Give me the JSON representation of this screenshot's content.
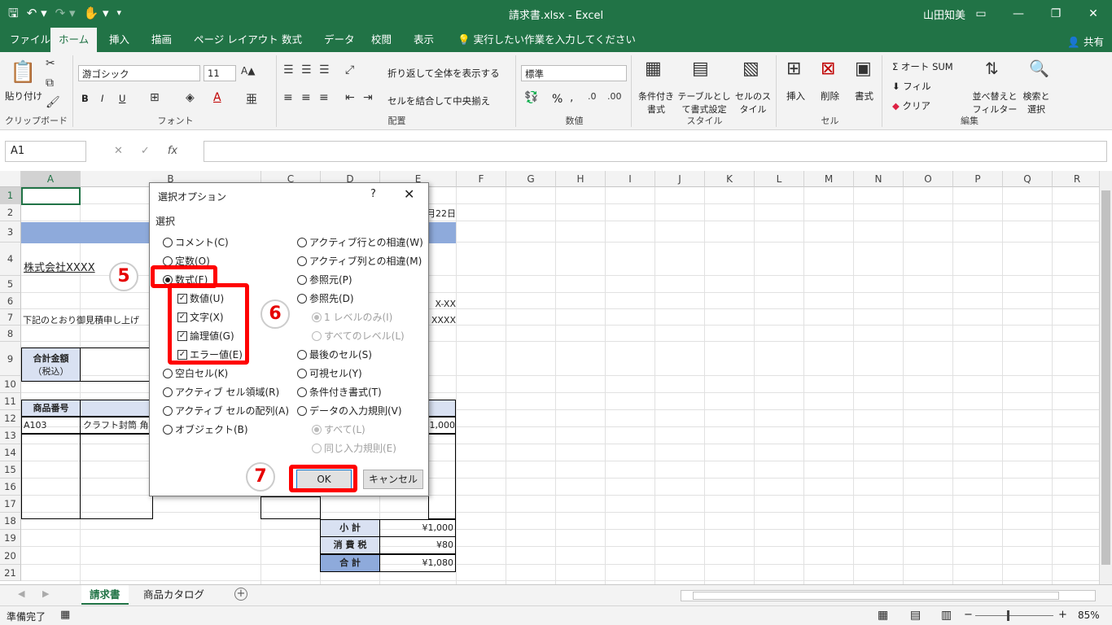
{
  "window": {
    "title": "請求書.xlsx - Excel",
    "user": "山田知美"
  },
  "ribbon_tabs": [
    "ファイル",
    "ホーム",
    "挿入",
    "描画",
    "ページ レイアウト",
    "数式",
    "データ",
    "校閲",
    "表示"
  ],
  "tell_me": "実行したい作業を入力してください",
  "share": "共有",
  "ribbon": {
    "clipboard": {
      "paste": "貼り付け",
      "label": "クリップボード"
    },
    "font": {
      "name": "游ゴシック",
      "size": "11",
      "label": "フォント",
      "bold": "B",
      "italic": "I",
      "underline": "U"
    },
    "alignment": {
      "wrap": "折り返して全体を表示する",
      "merge": "セルを結合して中央揃え",
      "label": "配置"
    },
    "number": {
      "format": "標準",
      "label": "数値",
      "percent": "%"
    },
    "styles": {
      "conditional": "条件付き書式",
      "table": "テーブルとして書式設定",
      "cell": "セルのスタイル",
      "label": "スタイル"
    },
    "cells": {
      "insert": "挿入",
      "delete": "削除",
      "format": "書式",
      "label": "セル"
    },
    "editing": {
      "autosum": "オート SUM",
      "fill": "フィル",
      "clear": "クリア",
      "sort": "並べ替えとフィルター",
      "find": "検索と選択",
      "label": "編集"
    }
  },
  "namebox": "A1",
  "fx": "fx",
  "columns": [
    "A",
    "B",
    "C",
    "D",
    "E",
    "F",
    "G",
    "H",
    "I",
    "J",
    "K",
    "L",
    "M",
    "N",
    "O",
    "P",
    "Q",
    "R"
  ],
  "rows": [
    "1",
    "2",
    "3",
    "4",
    "5",
    "6",
    "7",
    "8",
    "9",
    "10",
    "11",
    "12",
    "13",
    "14",
    "15",
    "16",
    "17",
    "18",
    "19",
    "20",
    "21"
  ],
  "cells": {
    "date": "月22日",
    "company": "株式会社XXXX",
    "tel": "X-XX",
    "fax": "XXXX",
    "greeting": "下記のとおり御見積申し上げ",
    "total_label": "合計金額",
    "tax_included": "（税込）",
    "product_no": "商品番号",
    "item_code": "A103",
    "item_name": "クラフト封筒 角",
    "item_amount": "1,000",
    "subtotal_label": "小 計",
    "subtotal": "¥1,000",
    "tax_label": "消 費 税",
    "tax": "¥80",
    "grand_label": "合 計",
    "grand": "¥1,080"
  },
  "dialog": {
    "title": "選択オプション",
    "help": "?",
    "section": "選択",
    "left_options": [
      {
        "label": "コメント(C)",
        "checked": false
      },
      {
        "label": "定数(O)",
        "checked": false
      },
      {
        "label": "数式(F)",
        "checked": true
      }
    ],
    "sub_checks": [
      "数値(U)",
      "文字(X)",
      "論理値(G)",
      "エラー値(E)"
    ],
    "left_options2": [
      "空白セル(K)",
      "アクティブ セル領域(R)",
      "アクティブ セルの配列(A)",
      "オブジェクト(B)"
    ],
    "right_options": [
      "アクティブ行との相違(W)",
      "アクティブ列との相違(M)",
      "参照元(P)",
      "参照先(D)"
    ],
    "right_sub": [
      "1 レベルのみ(I)",
      "すべてのレベル(L)"
    ],
    "right_options2": [
      "最後のセル(S)",
      "可視セル(Y)",
      "条件付き書式(T)",
      "データの入力規則(V)"
    ],
    "right_sub2": [
      "すべて(L)",
      "同じ入力規則(E)"
    ],
    "ok": "OK",
    "cancel": "キャンセル"
  },
  "annotations": {
    "step5": "5",
    "step6": "6",
    "step7": "7",
    "color": "#ff0000"
  },
  "sheets": [
    "請求書",
    "商品カタログ"
  ],
  "status": {
    "ready": "準備完了",
    "zoom": "85%"
  },
  "colors": {
    "excel_green": "#217346",
    "header_blue": "#8eaadb",
    "label_blue": "#d9e1f2"
  }
}
